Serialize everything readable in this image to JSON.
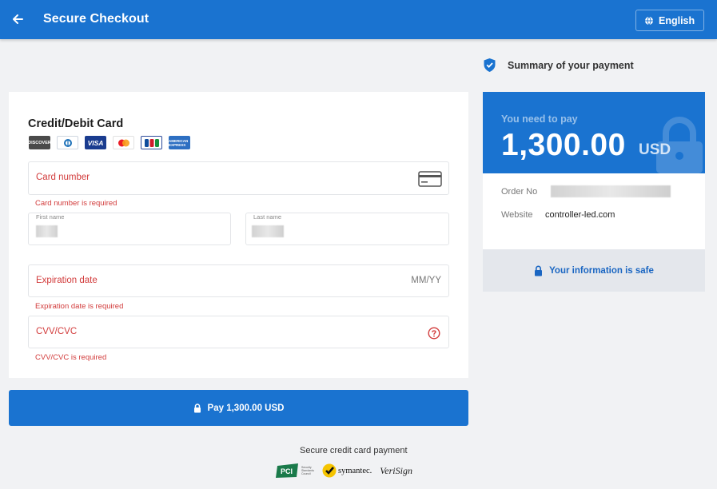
{
  "header": {
    "title": "Secure Checkout",
    "language_label": "English",
    "icons": {
      "back": "arrow-left-icon",
      "language": "globe-icon"
    }
  },
  "card_form": {
    "title": "Credit/Debit Card",
    "logos": [
      {
        "name": "discover-logo",
        "text": "DISCOVER"
      },
      {
        "name": "diners-club-logo",
        "text": ""
      },
      {
        "name": "visa-logo",
        "text": "VISA"
      },
      {
        "name": "mastercard-logo",
        "text": ""
      },
      {
        "name": "jcb-logo",
        "text": ""
      },
      {
        "name": "american-express-logo",
        "text": "AMERICAN EXPRESS"
      }
    ],
    "card_number": {
      "label": "Card number",
      "error": "Card number is required"
    },
    "first_name": {
      "label": "First name"
    },
    "last_name": {
      "label": "Last name"
    },
    "expiration": {
      "label": "Expiration date",
      "placeholder": "MM/YY",
      "error": "Expiration date is required"
    },
    "cvv": {
      "label": "CVV/CVC",
      "error": "CVV/CVC is required"
    }
  },
  "pay_button": {
    "label": "Pay 1,300.00 USD"
  },
  "footer": {
    "secure_text": "Secure credit card payment",
    "badges": [
      "PCI",
      "symantec.",
      "VeriSign"
    ]
  },
  "summary": {
    "title": "Summary of your payment",
    "need_to_pay": "You need to pay",
    "amount": "1,300.00",
    "currency": "USD",
    "order_no_label": "Order No",
    "website_label": "Website",
    "website_value": "controller-led.com",
    "safe_text": "Your information is safe"
  },
  "colors": {
    "primary": "#1a73d0",
    "error": "#d23b3b",
    "background": "#f1f2f4"
  }
}
